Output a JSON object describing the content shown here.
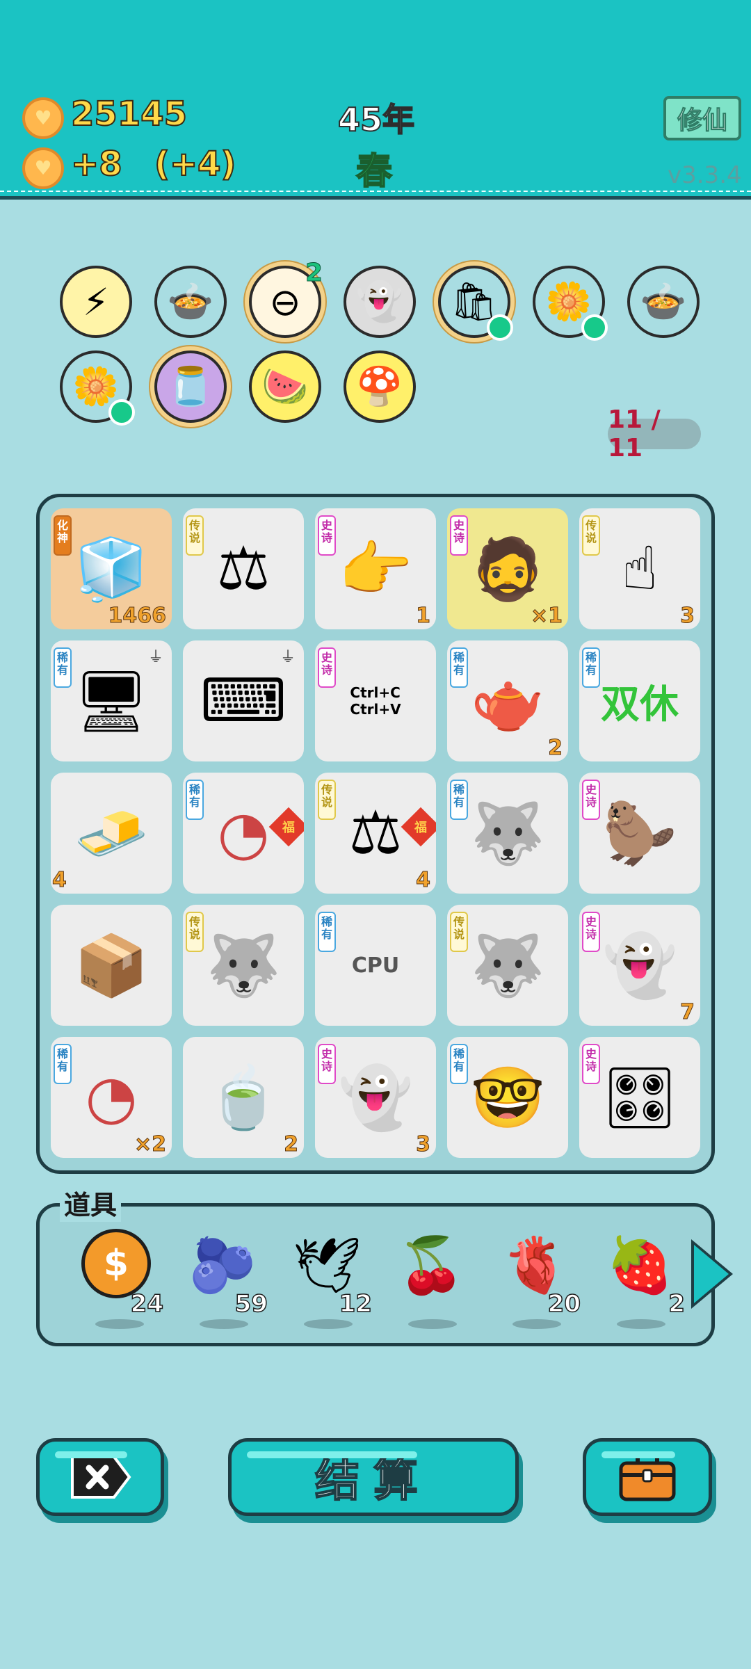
{
  "header": {
    "coins": "25145",
    "income": "+8",
    "bonus": "(+4)",
    "year": "45年",
    "season": "春",
    "xiuxian_label": "修仙",
    "version": "v3.3.4"
  },
  "buffs": {
    "row1": [
      {
        "name": "lightning-icon",
        "glyph": "⚡",
        "bg": "#fff4a8"
      },
      {
        "name": "pot-duck-icon",
        "glyph": "🍲",
        "bg": "#a9dde2"
      },
      {
        "name": "minus-icon",
        "glyph": "⊖",
        "bg": "#fff6e0",
        "count": "2"
      },
      {
        "name": "ghost-icon",
        "glyph": "👻",
        "bg": "#dddddd"
      },
      {
        "name": "trash-bag-icon",
        "glyph": "🛍",
        "bg": "#a9dde2"
      },
      {
        "name": "flower-pot-icon",
        "glyph": "🌼",
        "bg": "#a9dde2"
      },
      {
        "name": "pot-duck-icon",
        "glyph": "🍲",
        "bg": "#a9dde2"
      }
    ],
    "row2": [
      {
        "name": "flower-pot-icon",
        "glyph": "🌼",
        "bg": "#a9dde2"
      },
      {
        "name": "jar-icon",
        "glyph": "🫙",
        "bg": "#c9a6e8"
      },
      {
        "name": "fruit-basket-icon",
        "glyph": "🍉",
        "bg": "#fff06a"
      },
      {
        "name": "mushroom-icon",
        "glyph": "🍄",
        "bg": "#fff06a"
      }
    ]
  },
  "slot_counter": "11 / 11",
  "board": {
    "rows": [
      [
        {
          "name": "fridge-icon",
          "glyph": "🧊",
          "tag": "化神",
          "tier": "god",
          "qty": "1466",
          "bg": "#f4cc9c"
        },
        {
          "name": "scale-icon",
          "glyph": "⚖",
          "tag": "传说",
          "tier": "legend",
          "qty": ""
        },
        {
          "name": "pointing-hand-icon",
          "glyph": "👉",
          "tag": "史诗",
          "tier": "epic",
          "qty": "1"
        },
        {
          "name": "mustache-man-icon",
          "glyph": "🧔",
          "tag": "史诗",
          "tier": "epic",
          "qty": "×1",
          "bg": "#f0e890"
        },
        {
          "name": "finger-up-icon",
          "glyph": "☝",
          "tag": "传说",
          "tier": "legend",
          "qty": "3"
        }
      ],
      [
        {
          "name": "pc-tower-icon",
          "glyph": "🖥",
          "tag": "稀有",
          "tier": "rare",
          "qty": "",
          "usb": true
        },
        {
          "name": "keyboard-icon",
          "glyph": "⌨",
          "tag": "",
          "tier": "",
          "qty": "",
          "usb": true
        },
        {
          "name": "ctrl-c-v-icon",
          "glyph": "Ctrl+C\nCtrl+V",
          "tag": "史诗",
          "tier": "epic",
          "qty": ""
        },
        {
          "name": "teapot-icon",
          "glyph": "🫖",
          "tag": "稀有",
          "tier": "rare",
          "qty": "2"
        },
        {
          "name": "double-rest-icon",
          "glyph": "双休",
          "tag": "稀有",
          "tier": "rare",
          "qty": ""
        }
      ],
      [
        {
          "name": "gold-bars-icon",
          "glyph": "🧈",
          "tag": "",
          "tier": "",
          "qty": "",
          "qtyl": "4"
        },
        {
          "name": "gauge-fu-icon",
          "glyph": "◔",
          "tag": "稀有",
          "tier": "rare",
          "qty": "",
          "fu": "福"
        },
        {
          "name": "scale-fu-icon",
          "glyph": "⚖",
          "tag": "传说",
          "tier": "legend",
          "qty": "4",
          "fu": "福"
        },
        {
          "name": "husky-icon",
          "glyph": "🐺",
          "tag": "稀有",
          "tier": "rare",
          "qty": ""
        },
        {
          "name": "marmot-icon",
          "glyph": "🦫",
          "tag": "史诗",
          "tier": "epic",
          "qty": ""
        }
      ],
      [
        {
          "name": "parcel-box-icon",
          "glyph": "📦",
          "tag": "",
          "tier": "",
          "qty": ""
        },
        {
          "name": "husky-king-icon",
          "glyph": "🐺",
          "tag": "传说",
          "tier": "legend",
          "qty": ""
        },
        {
          "name": "cpu-icon",
          "glyph": "CPU",
          "tag": "稀有",
          "tier": "rare",
          "qty": ""
        },
        {
          "name": "husky-king-icon",
          "glyph": "🐺",
          "tag": "传说",
          "tier": "legend",
          "qty": ""
        },
        {
          "name": "ghost-icon",
          "glyph": "👻",
          "tag": "史诗",
          "tier": "epic",
          "qty": "7"
        }
      ],
      [
        {
          "name": "gauge-icon",
          "glyph": "◔",
          "tag": "稀有",
          "tier": "rare",
          "qty": "×2"
        },
        {
          "name": "tea-bag-icon",
          "glyph": "🍵",
          "tag": "",
          "tier": "",
          "qty": "2"
        },
        {
          "name": "ghost-icon",
          "glyph": "👻",
          "tag": "史诗",
          "tier": "epic",
          "qty": "3"
        },
        {
          "name": "nerd-face-icon",
          "glyph": "🤓",
          "tag": "稀有",
          "tier": "rare",
          "qty": ""
        },
        {
          "name": "graphics-card-icon",
          "glyph": "🎛",
          "tag": "史诗",
          "tier": "epic",
          "qty": ""
        }
      ]
    ]
  },
  "items": {
    "title": "道具",
    "list": [
      {
        "name": "dollar-coin-icon",
        "glyph": "$",
        "qty": "24"
      },
      {
        "name": "blueberry-icon",
        "glyph": "🫐",
        "qty": "59"
      },
      {
        "name": "dove-icon",
        "glyph": "🕊",
        "qty": "12"
      },
      {
        "name": "lychee-icon",
        "glyph": "🍒",
        "qty": ""
      },
      {
        "name": "liver-icon",
        "glyph": "🫀",
        "qty": "20"
      },
      {
        "name": "strawberry-icon",
        "glyph": "🍓",
        "qty": "2"
      }
    ]
  },
  "bottom": {
    "settle_label": "结算"
  }
}
